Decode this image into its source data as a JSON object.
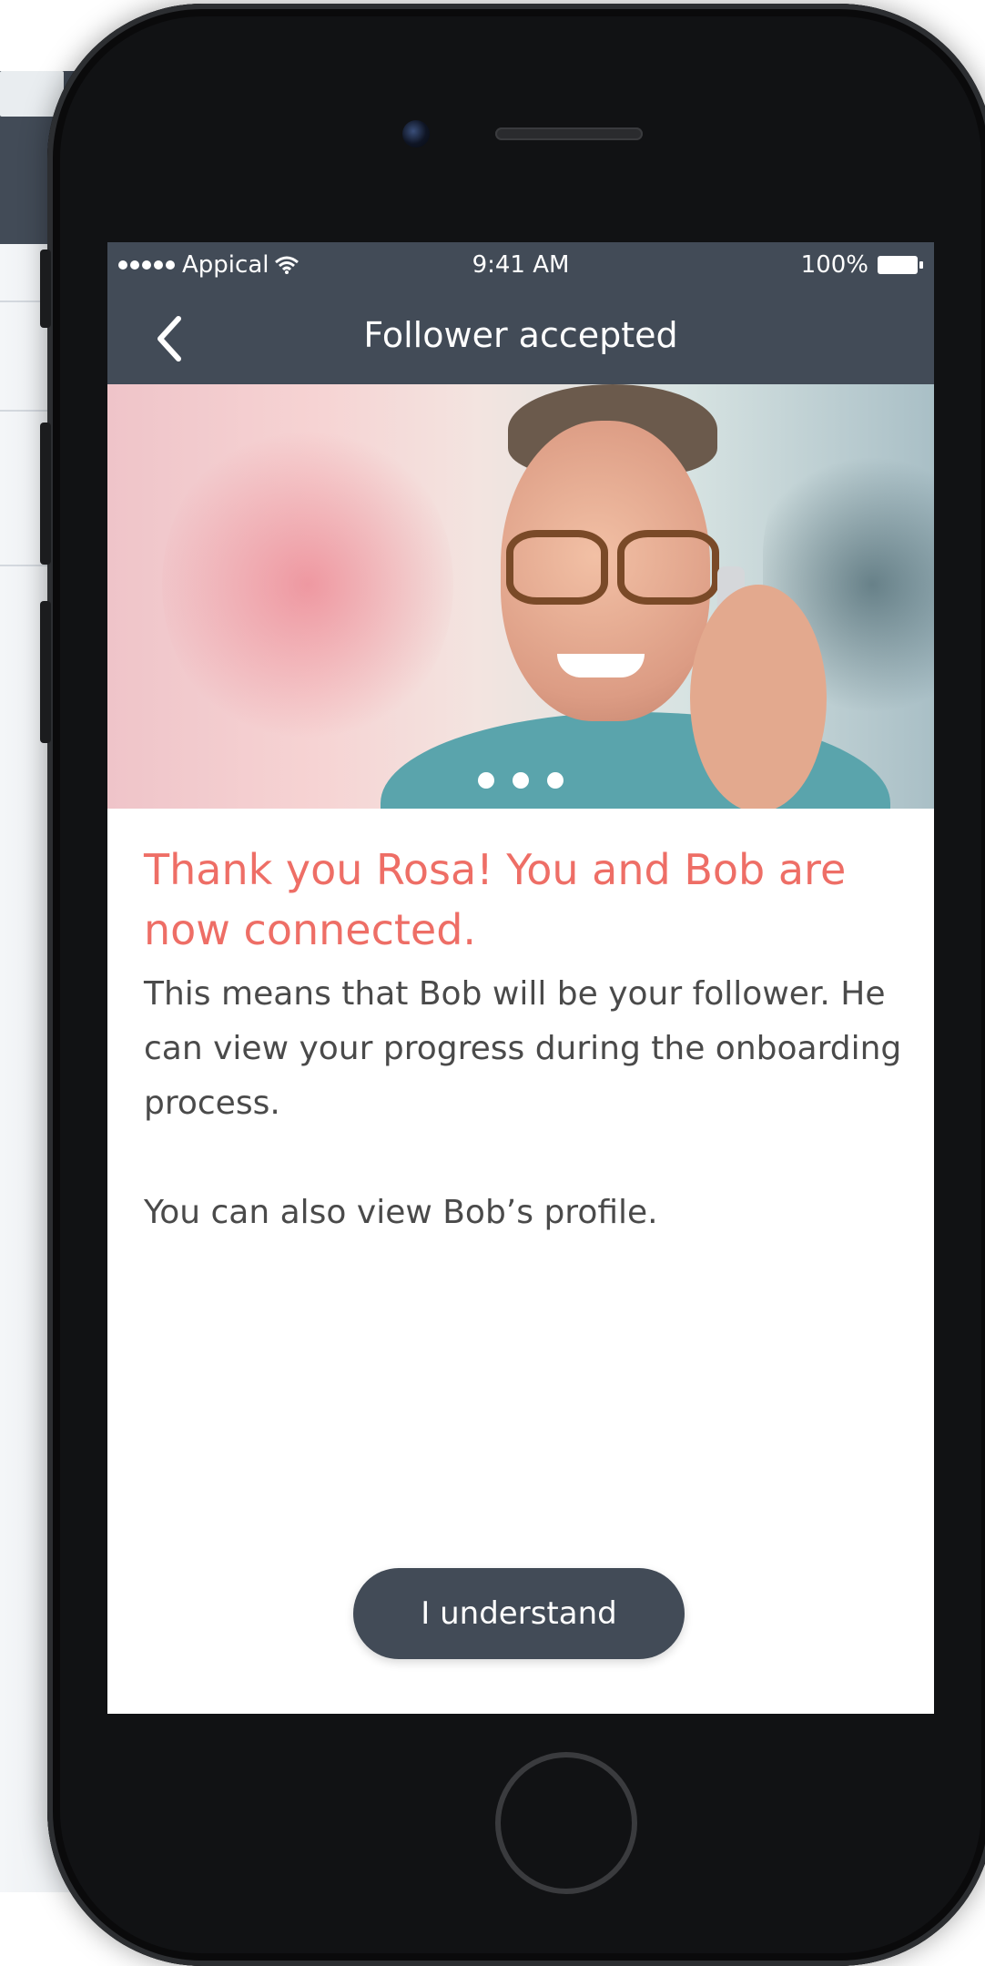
{
  "status_bar": {
    "carrier": "Appical",
    "time": "9:41 AM",
    "battery": "100%"
  },
  "nav": {
    "title": "Follower accepted",
    "back_icon": "chevron-left-icon"
  },
  "hero": {
    "pager_pages": 3
  },
  "content": {
    "headline": "Thank you Rosa! You and Bob are now connected.",
    "paragraph_1": "This means that Bob will be your follower. He can view your progress during the onboarding process.",
    "paragraph_2": "You can also view Bob’s profile."
  },
  "actions": {
    "primary_label": "I understand"
  },
  "colors": {
    "header": "#424b57",
    "accent": "#ee6e66",
    "body_text": "#4a4a4a"
  }
}
